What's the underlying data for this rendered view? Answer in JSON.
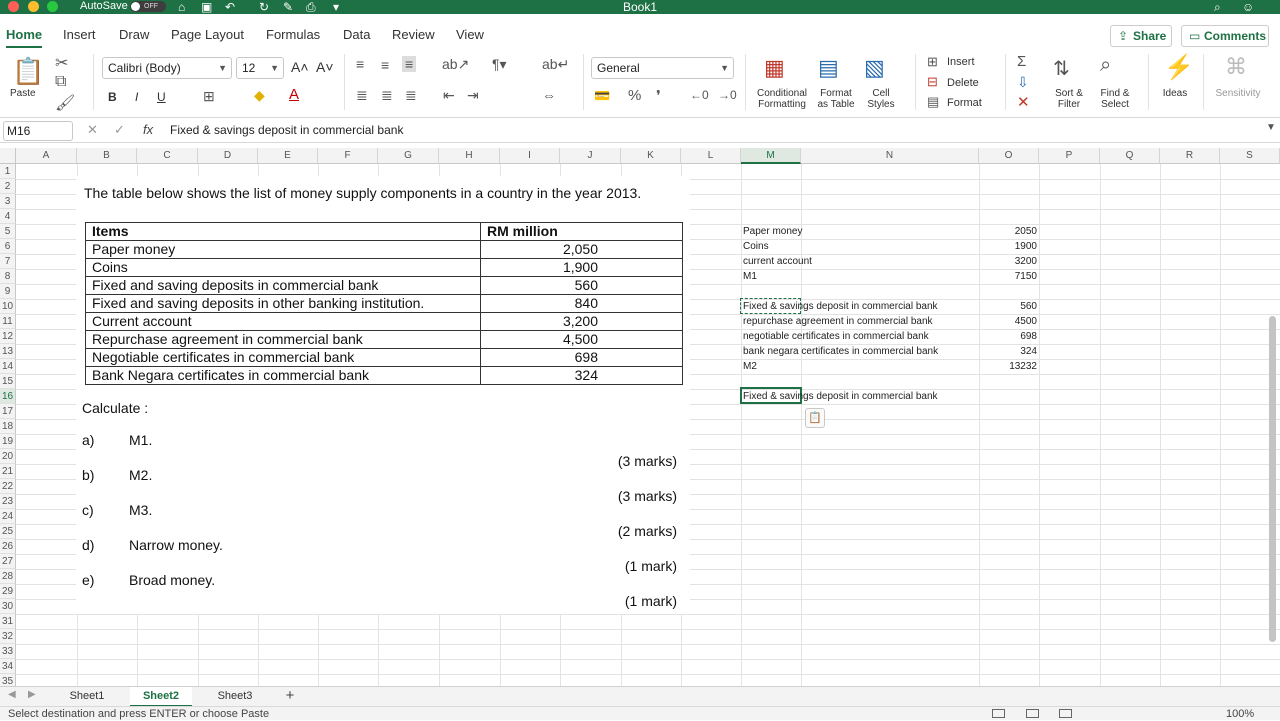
{
  "titlebar": {
    "autosave": "AutoSave",
    "autosave_state": "OFF",
    "document": "Book1"
  },
  "tabs": [
    "Home",
    "Insert",
    "Draw",
    "Page Layout",
    "Formulas",
    "Data",
    "Review",
    "View"
  ],
  "buttons": {
    "share": "Share",
    "comments": "Comments"
  },
  "ribbon": {
    "paste": "Paste",
    "font_name": "Calibri (Body)",
    "font_size": "12",
    "bold": "B",
    "italic": "I",
    "underline": "U",
    "number_format": "General",
    "conditional_formatting": "Conditional\nFormatting",
    "format_as_table": "Format\nas Table",
    "cell_styles": "Cell\nStyles",
    "insert": "Insert",
    "delete": "Delete",
    "format": "Format",
    "sort_filter": "Sort &\nFilter",
    "find_select": "Find &\nSelect",
    "ideas": "Ideas",
    "sensitivity": "Sensitivity"
  },
  "formula_bar": {
    "name_box": "M16",
    "fx": "fx",
    "content": "Fixed & savings deposit in commercial bank"
  },
  "columns": [
    "A",
    "B",
    "C",
    "D",
    "E",
    "F",
    "G",
    "H",
    "I",
    "J",
    "K",
    "L",
    "M",
    "N",
    "O",
    "P",
    "Q",
    "R",
    "S"
  ],
  "selected_column": "M",
  "selected_row": 16,
  "row_count": 36,
  "picture": {
    "intro": "The table below shows the list of money supply components in a country in the year 2013.",
    "headers": [
      "Items",
      "RM million"
    ],
    "rows": [
      [
        "Paper money",
        "2,050"
      ],
      [
        "Coins",
        "1,900"
      ],
      [
        "Fixed and saving deposits in commercial bank",
        "560"
      ],
      [
        "Fixed and saving deposits in other banking institution.",
        "840"
      ],
      [
        "Current account",
        "3,200"
      ],
      [
        "Repurchase agreement in commercial bank",
        "4,500"
      ],
      [
        "Negotiable certificates  in commercial bank",
        "698"
      ],
      [
        "Bank Negara certificates in commercial bank",
        "324"
      ]
    ],
    "calculate": "Calculate :",
    "questions": [
      {
        "letter": "a)",
        "text": "M1.",
        "marks": "(3 marks)"
      },
      {
        "letter": "b)",
        "text": "M2.",
        "marks": "(3 marks)"
      },
      {
        "letter": "c)",
        "text": "M3.",
        "marks": "(2 marks)"
      },
      {
        "letter": "d)",
        "text": "Narrow money.",
        "marks": "(1 mark)"
      },
      {
        "letter": "e)",
        "text": "Broad money.",
        "marks": "(1 mark)"
      }
    ]
  },
  "worksheet_cells": [
    {
      "row": 5,
      "m": "Paper money",
      "o": "2050"
    },
    {
      "row": 6,
      "m": "Coins",
      "o": "1900"
    },
    {
      "row": 7,
      "m": "current account",
      "o": "3200"
    },
    {
      "row": 8,
      "m": "M1",
      "o": "7150"
    },
    {
      "row": 10,
      "m": "Fixed & savings deposit in commercial bank",
      "o": "560"
    },
    {
      "row": 11,
      "m": "repurchase agreement in commercial bank",
      "o": "4500"
    },
    {
      "row": 12,
      "m": "negotiable certificates in commercial bank",
      "o": "698"
    },
    {
      "row": 13,
      "m": "bank negara certificates in commercial bank",
      "o": "324"
    },
    {
      "row": 14,
      "m": "M2",
      "o": "13232"
    },
    {
      "row": 16,
      "m": "Fixed & savings deposit in commercial bank",
      "o": ""
    }
  ],
  "sheets": [
    "Sheet1",
    "Sheet2",
    "Sheet3"
  ],
  "active_sheet": "Sheet2",
  "status": {
    "message": "Select destination and press ENTER or choose Paste",
    "zoom": "100%"
  }
}
